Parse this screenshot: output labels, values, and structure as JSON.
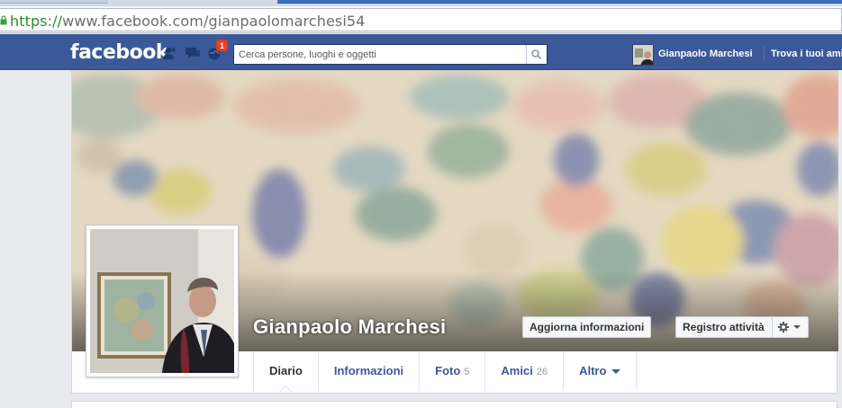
{
  "browser": {
    "url_scheme": "https://",
    "url_rest": "www.facebook.com/gianpaolomarchesi54"
  },
  "topbar": {
    "logo": "facebook",
    "notification_count": "1",
    "search_placeholder": "Cerca persone, luoghi e oggetti",
    "user_name": "Gianpaolo Marchesi",
    "find_friends": "Trova i tuoi amici",
    "colors": {
      "bar": "#3b5998",
      "badge": "#f03d25"
    }
  },
  "profile": {
    "name": "Gianpaolo Marchesi",
    "update_button": "Aggiorna informazioni",
    "activity_button": "Registro attività"
  },
  "tabs": [
    {
      "label": "Diario",
      "count": "",
      "active": true
    },
    {
      "label": "Informazioni",
      "count": ""
    },
    {
      "label": "Foto",
      "count": "5"
    },
    {
      "label": "Amici",
      "count": "26"
    },
    {
      "label": "Altro",
      "count": "",
      "dropdown": true
    }
  ],
  "icons": {
    "friend_requests": "friend-requests-icon",
    "messages": "messages-icon",
    "notifications": "globe-notifications-icon",
    "search": "magnifier-icon",
    "settings": "gear-icon",
    "dropdown": "caret-down-icon"
  }
}
